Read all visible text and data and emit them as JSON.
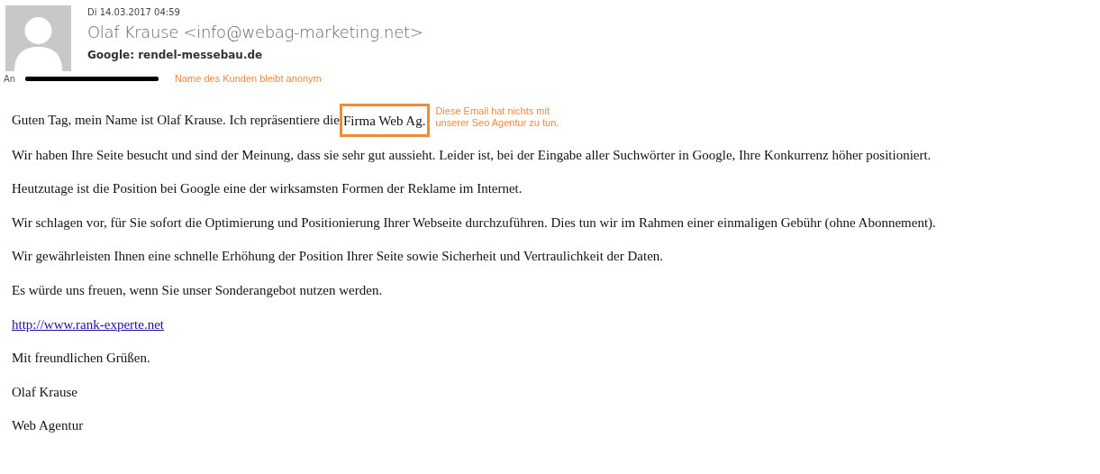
{
  "header": {
    "date": "Di 14.03.2017 04:59",
    "sender": "Olaf Krause <info@webag-marketing.net>",
    "subject": "Google: rendel-messebau.de",
    "to_label": "An",
    "to_redacted": true,
    "to_note": "Name des Kunden bleibt anonym"
  },
  "body": [
    {
      "kind": "highlighted",
      "text": "Guten Tag, mein Name ist Olaf Krause. Ich repräsentiere die ",
      "highlight": "Firma Web Ag.",
      "note_lines": [
        "Diese Email hat nichts mit",
        "unserer Seo Agentur zu tun."
      ]
    },
    {
      "kind": "text",
      "text": "Wir haben Ihre Seite besucht und sind der Meinung, dass sie sehr gut aussieht. Leider ist, bei der Eingabe aller Suchwörter in Google, Ihre Konkurrenz höher positioniert."
    },
    {
      "kind": "text",
      "text": "Heutzutage ist die Position bei Google eine der wirksamsten Formen der Reklame im Internet."
    },
    {
      "kind": "text",
      "text": "Wir schlagen vor, für Sie sofort die Optimierung und Positionierung Ihrer Webseite durchzuführen. Dies tun wir im Rahmen einer einmaligen Gebühr (ohne Abonnement)."
    },
    {
      "kind": "text",
      "text": "Wir gewährleisten Ihnen eine schnelle Erhöhung der Position Ihrer Seite sowie Sicherheit und Vertraulichkeit der Daten."
    },
    {
      "kind": "text",
      "text": "Es würde uns freuen, wenn Sie unser Sonderangebot nutzen werden."
    },
    {
      "kind": "link",
      "text": "http://www.rank-experte.net"
    },
    {
      "kind": "text",
      "text": "Mit freundlichen Grüßen."
    },
    {
      "kind": "text",
      "text": "Olaf Krause"
    },
    {
      "kind": "text",
      "text": "Web Agentur"
    }
  ]
}
